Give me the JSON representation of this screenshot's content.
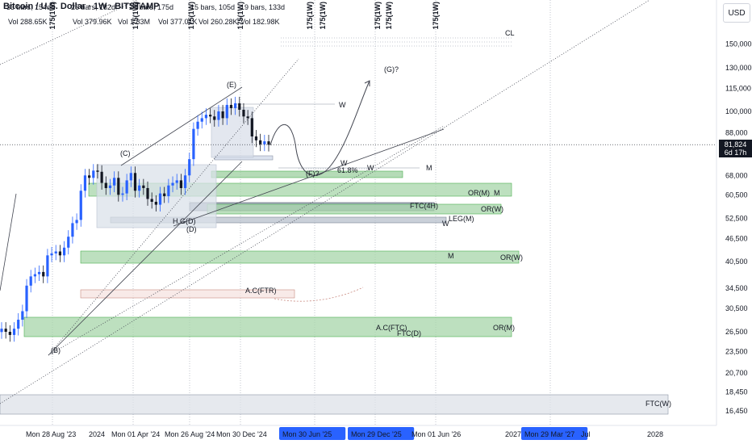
{
  "header": {
    "title": "Bitcoin / U.S. Dollar · 1W · BITSTAMP",
    "bar_counts": [
      "33 bars, 154d",
      "26 bars, 182d",
      "24 bars, 175d",
      "15 bars, 105d",
      "19 bars, 133d"
    ],
    "volumes": [
      "Vol 288.65K",
      "Vol 379.96K",
      "Vol 1.83M",
      "Vol 377.01K",
      "Vol 260.28K",
      "Vol 182.98K"
    ]
  },
  "currency_button": "USD",
  "last_price": {
    "value": "81,824",
    "countdown": "6d 17h"
  },
  "chart_data": {
    "type": "candlestick",
    "title": "Bitcoin / U.S. Dollar · 1W · BITSTAMP",
    "y_scale": "log",
    "ylim": [
      14500,
      180000
    ],
    "y_ticks": [
      {
        "label": "150,000",
        "value": 150000
      },
      {
        "label": "130,000",
        "value": 130000
      },
      {
        "label": "115,000",
        "value": 115000
      },
      {
        "label": "100,000",
        "value": 100000
      },
      {
        "label": "88,000",
        "value": 88000
      },
      {
        "label": "68,000",
        "value": 68000
      },
      {
        "label": "60,500",
        "value": 60500
      },
      {
        "label": "52,500",
        "value": 52500
      },
      {
        "label": "46,500",
        "value": 46500
      },
      {
        "label": "40,500",
        "value": 40500
      },
      {
        "label": "34,500",
        "value": 34500
      },
      {
        "label": "30,500",
        "value": 30500
      },
      {
        "label": "26,500",
        "value": 26500
      },
      {
        "label": "23,500",
        "value": 23500
      },
      {
        "label": "20,700",
        "value": 20700
      },
      {
        "label": "18,450",
        "value": 18450
      },
      {
        "label": "16,450",
        "value": 16450
      }
    ],
    "x_labels": [
      {
        "text": "Mon 28 Aug '23",
        "highlight": false
      },
      {
        "text": "2024",
        "highlight": false
      },
      {
        "text": "Mon 01 Apr '24",
        "highlight": false
      },
      {
        "text": "Mon 26 Aug '24",
        "highlight": false
      },
      {
        "text": "Mon 30 Dec '24",
        "highlight": false
      },
      {
        "text": "Mon 30 Jun '25",
        "highlight": true
      },
      {
        "text": "Mon 29 Dec '25",
        "highlight": true
      },
      {
        "text": "Mon 01 Jun '26",
        "highlight": false
      },
      {
        "text": "2027",
        "highlight": false
      },
      {
        "text": "Mon 29 Mar '27",
        "highlight": true
      },
      {
        "text": "Jul",
        "highlight": false
      },
      {
        "text": "2028",
        "highlight": false
      }
    ],
    "vertical_labels": [
      "175(1W)",
      "175(1W)",
      "175(1W)",
      "175(1W)",
      "175(1W)",
      "175(1W)",
      "175(1W)",
      "175(1W)",
      "175(1W)"
    ],
    "wave_labels": [
      "(B)",
      "(C)",
      "(D)",
      "(E)",
      "(F)?",
      "(G)?"
    ],
    "annotations": [
      "CL",
      "W",
      "W",
      "W",
      "M",
      "M",
      "M",
      "61.8%",
      "OR(M)",
      "OR(W)",
      "FTC(4H)",
      "LEG(M)",
      "W",
      "OR(W)",
      "A.C(FTR)",
      "A.C(FTC)",
      "FTC(D)",
      "OR(M)",
      "FTC(W)",
      "H.G(D)"
    ],
    "weekly_close_sketch": [
      27000,
      26500,
      26000,
      27000,
      28500,
      30000,
      35000,
      37000,
      37500,
      38000,
      37000,
      42000,
      42500,
      43000,
      42000,
      44000,
      47000,
      51000,
      52000,
      62000,
      68000,
      67000,
      70000,
      69500,
      65000,
      63000,
      64000,
      67000,
      60500,
      61000,
      66000,
      69000,
      62000,
      64000,
      63000,
      59000,
      58000,
      57000,
      61000,
      60000,
      64000,
      65000,
      66000,
      63000,
      68000,
      75000,
      90000,
      94000,
      96000,
      98000,
      97000,
      95000,
      100000,
      96000,
      104000,
      102000,
      105000,
      101000,
      97000,
      96000,
      86000,
      84000,
      82000,
      83500,
      81824
    ],
    "last_value": 81824
  }
}
